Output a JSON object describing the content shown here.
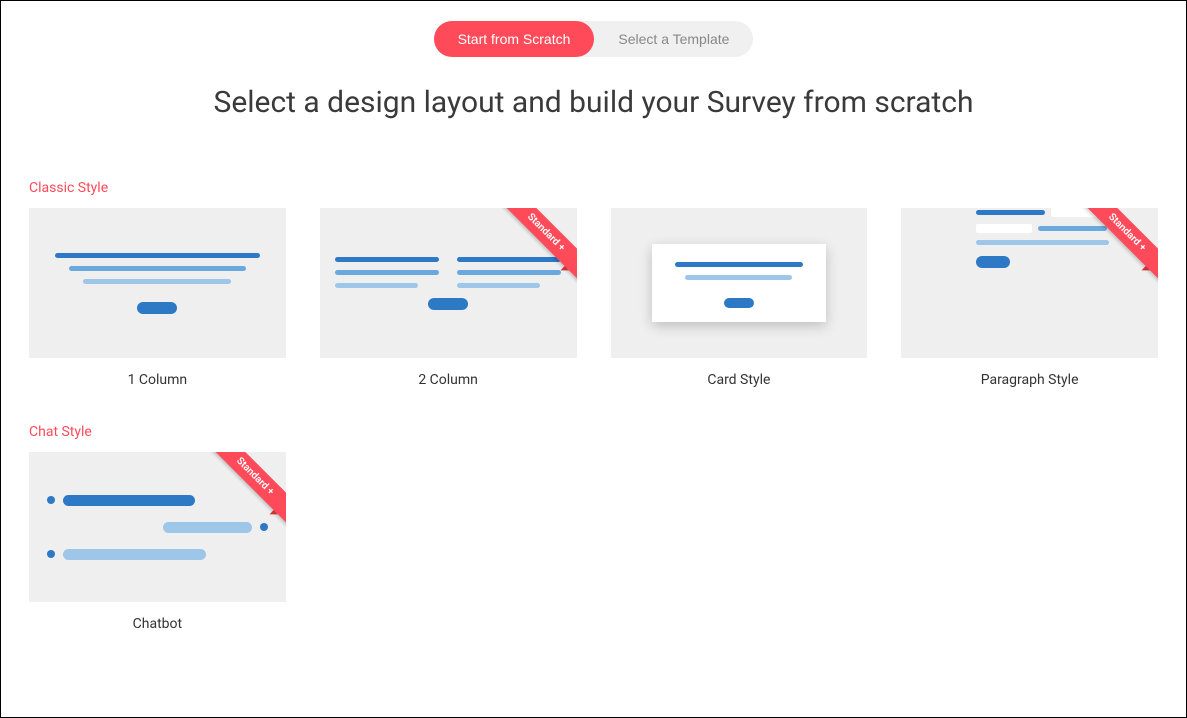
{
  "tabs": {
    "scratch_label": "Start from Scratch",
    "template_label": "Select a Template"
  },
  "title": "Select a design layout and build your Survey from scratch",
  "ribbon_label": "Standard +",
  "sections": {
    "classic": {
      "label": "Classic Style",
      "options": [
        {
          "title": "1 Column"
        },
        {
          "title": "2 Column"
        },
        {
          "title": "Card Style"
        },
        {
          "title": "Paragraph Style"
        }
      ]
    },
    "chat": {
      "label": "Chat Style",
      "options": [
        {
          "title": "Chatbot"
        }
      ]
    }
  }
}
